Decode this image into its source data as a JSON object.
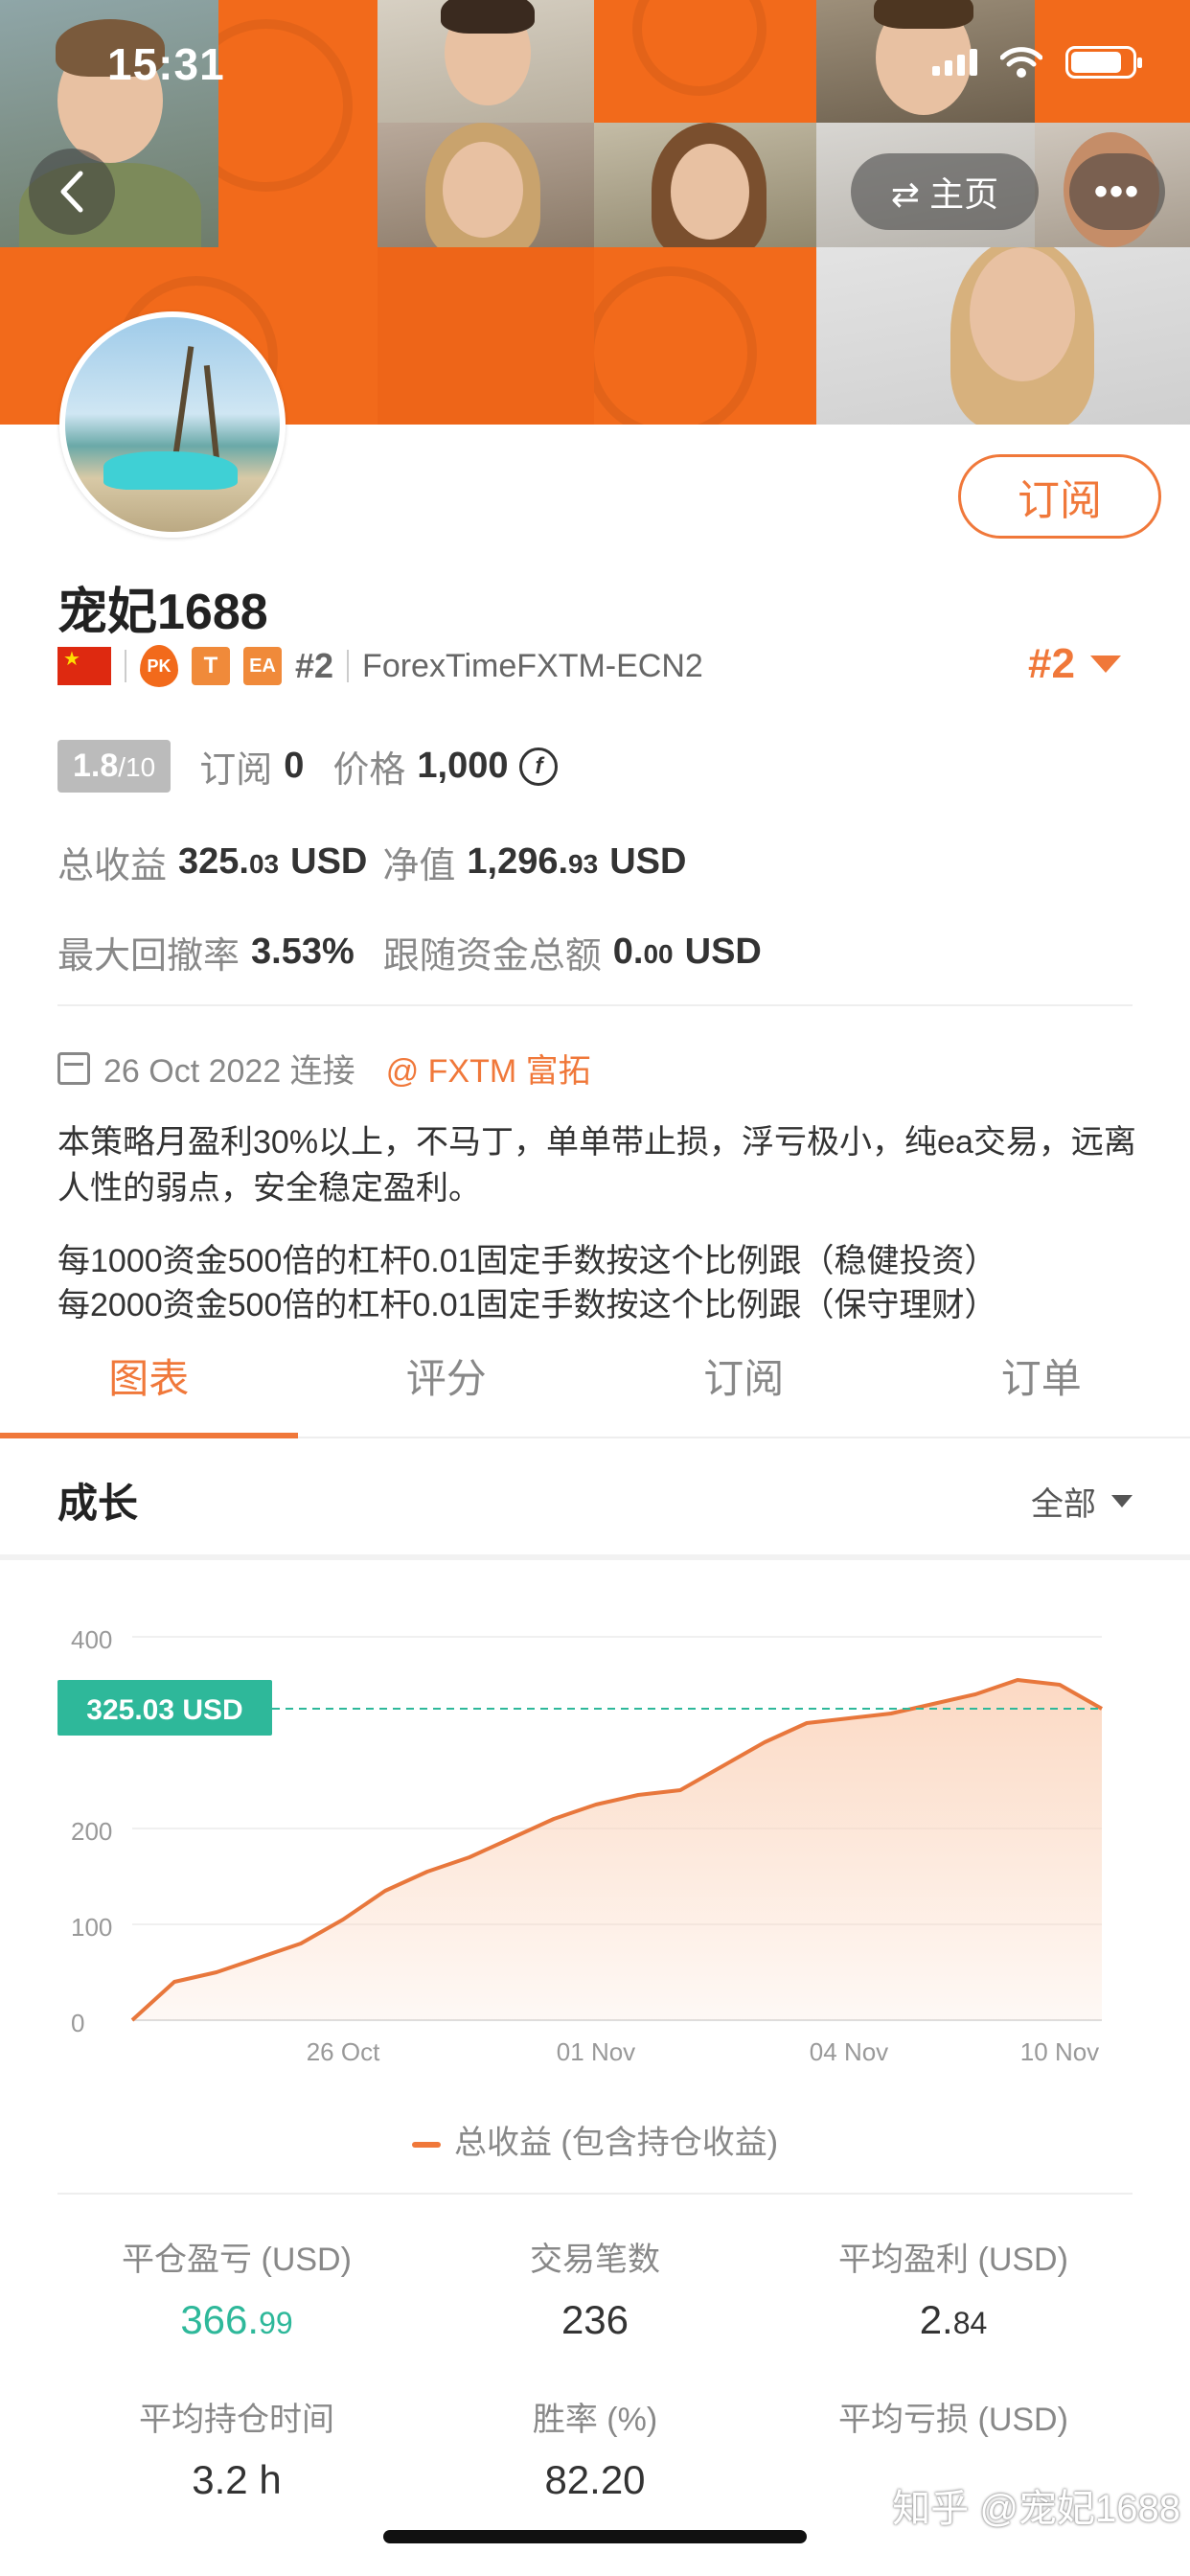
{
  "status_bar": {
    "time": "15:31"
  },
  "nav": {
    "home_label": "⇄ 主页",
    "back_icon": "chevron-left-icon",
    "more_icon": "more-icon"
  },
  "profile": {
    "name": "宠妃1688",
    "subscribe_label": "订阅",
    "badges": {
      "pk": "PK",
      "t": "T",
      "ea": "EA",
      "rank": "#2",
      "broker": "ForexTimeFXTM-ECN2"
    },
    "rank_right": "#2",
    "score": "1.8",
    "score_max": "/10",
    "subscribe_count_label": "订阅",
    "subscribe_count": "0",
    "price_label": "价格",
    "price": "1,000",
    "coin_symbol": "f",
    "total_profit_label": "总收益",
    "total_profit_int": "325.",
    "total_profit_dec": "03",
    "total_profit_unit": "USD",
    "equity_label": "净值",
    "equity_int": "1,296.",
    "equity_dec": "93",
    "equity_unit": "USD",
    "drawdown_label": "最大回撤率",
    "drawdown": "3.53%",
    "follow_funds_label": "跟随资金总额",
    "follow_funds_int": "0.",
    "follow_funds_dec": "00",
    "follow_funds_unit": "USD",
    "connected_date": "26 Oct 2022 连接",
    "broker_link": "@ FXTM 富拓",
    "description_1": "本策略月盈利30%以上，不马丁，单单带止损，浮亏极小，纯ea交易，远离人性的弱点，安全稳定盈利。",
    "description_2": "每1000资金500倍的杠杆0.01固定手数按这个比例跟（稳健投资）",
    "description_3": "每2000资金500倍的杠杆0.01固定手数按这个比例跟（保守理财）"
  },
  "tabs": [
    "图表",
    "评分",
    "订阅",
    "订单"
  ],
  "section": {
    "title": "成长",
    "range_label": "全部"
  },
  "chart_data": {
    "type": "area",
    "ylim": [
      0,
      400
    ],
    "yticks": [
      "0",
      "100",
      "200",
      "400"
    ],
    "xticks": [
      "26 Oct",
      "01 Nov",
      "04 Nov",
      "10 Nov"
    ],
    "xtick_index": [
      5,
      11,
      17,
      22
    ],
    "current_label": "325.03 USD",
    "current_value": 325.03,
    "series": [
      {
        "name": "总收益 (包含持仓收益)",
        "values": [
          0,
          40,
          50,
          65,
          80,
          105,
          135,
          155,
          170,
          190,
          210,
          225,
          235,
          240,
          265,
          290,
          310,
          315,
          320,
          330,
          340,
          355,
          350,
          325
        ]
      }
    ],
    "colors": {
      "line": "#e8773c",
      "fill": "#fbd5bd",
      "current": "#2eb89a"
    }
  },
  "legend": "总收益 (包含持仓收益)",
  "stats": [
    {
      "label": "平仓盈亏 (USD)",
      "int": "366.",
      "dec": "99",
      "green": true
    },
    {
      "label": "交易笔数",
      "int": "236",
      "dec": ""
    },
    {
      "label": "平均盈利 (USD)",
      "int": "2.",
      "dec": "84"
    },
    {
      "label": "平均持仓时间",
      "int": "3.2 h",
      "dec": ""
    },
    {
      "label": "胜率 (%)",
      "int": "82.20",
      "dec": ""
    },
    {
      "label": "平均亏损 (USD)",
      "int": "",
      "dec": ""
    }
  ],
  "watermark": "知乎 @宠妃1688",
  "colors": {
    "accent": "#f0783a",
    "brand_orange": "#f26a1b",
    "green": "#2eb89a"
  }
}
